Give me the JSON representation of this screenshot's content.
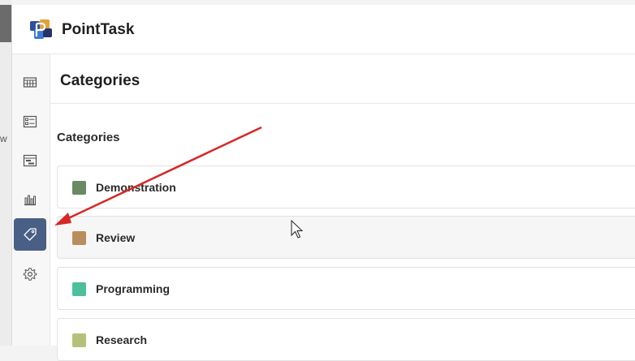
{
  "app": {
    "name": "PointTask"
  },
  "background": {
    "fragment_text": "w"
  },
  "nav": {
    "items": [
      {
        "icon": "board-icon",
        "active": false
      },
      {
        "icon": "list-icon",
        "active": false
      },
      {
        "icon": "timeline-icon",
        "active": false
      },
      {
        "icon": "chart-icon",
        "active": false
      },
      {
        "icon": "tag-icon",
        "active": true
      },
      {
        "icon": "gear-icon",
        "active": false
      }
    ]
  },
  "page": {
    "title": "Categories",
    "section_title": "Categories"
  },
  "categories": [
    {
      "label": "Demonstration",
      "color": "#6b8a63"
    },
    {
      "label": "Review",
      "color": "#b98d5c"
    },
    {
      "label": "Programming",
      "color": "#4dbf9c"
    },
    {
      "label": "Research",
      "color": "#b7c07a"
    }
  ],
  "annotation": {
    "arrow_color": "#d62828"
  },
  "colors": {
    "nav_active": "#4a5f86"
  }
}
